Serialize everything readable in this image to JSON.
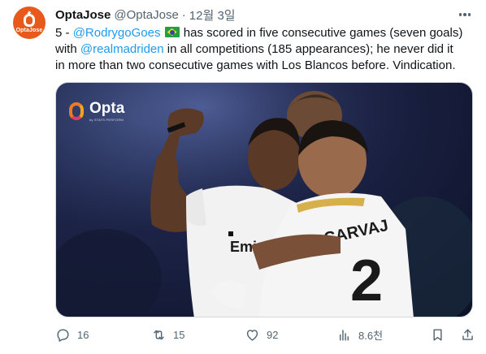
{
  "tweet": {
    "author": {
      "display_name": "OptaJose",
      "handle": "@OptaJose",
      "avatar_text": "OptaJose"
    },
    "separator": "·",
    "timestamp": "12월 3일",
    "text": {
      "line1_prefix": "5 - ",
      "mention1": "@RodrygoGoes",
      "flag": "brazil-flag-emoji",
      "line1_suffix": " has scored in five consecutive games (seven goals)",
      "line2_prefix": "with ",
      "mention2": "@realmadriden",
      "line2_suffix": " in all competitions (185 appearances); he never did it",
      "line3": "in more than two consecutive games with Los Blancos before. Vindication."
    },
    "media": {
      "description": "Rodrygo and Carvajal celebrating a goal",
      "logo_text": "Opta",
      "logo_subtext": "by STATS PERFORM",
      "shirt_text": "Emira FLY",
      "shirt_back_text": "CARVAJ",
      "shirt_number": "2"
    },
    "actions": {
      "replies": "16",
      "reposts": "15",
      "likes": "92",
      "views": "8.6천"
    }
  },
  "colors": {
    "link": "#1d9bf0",
    "text": "#0f1419",
    "muted": "#536471",
    "avatar_bg": "#e8591c"
  }
}
